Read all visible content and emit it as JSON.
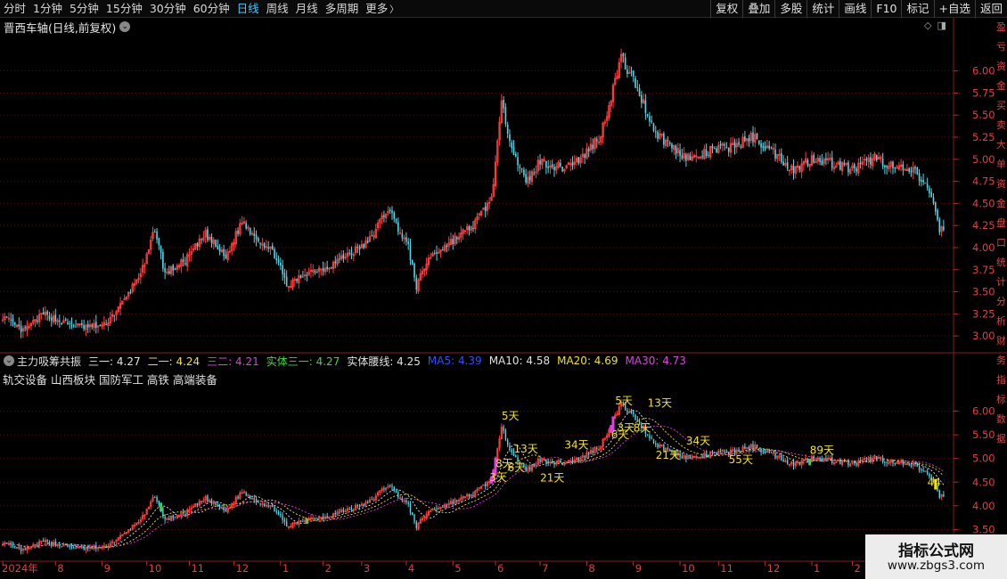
{
  "topbar": {
    "tabs": [
      {
        "label": "分时",
        "active": false
      },
      {
        "label": "1分钟",
        "active": false
      },
      {
        "label": "5分钟",
        "active": false
      },
      {
        "label": "15分钟",
        "active": false
      },
      {
        "label": "30分钟",
        "active": false
      },
      {
        "label": "60分钟",
        "active": false
      },
      {
        "label": "日线",
        "active": true
      },
      {
        "label": "周线",
        "active": false
      },
      {
        "label": "月线",
        "active": false
      },
      {
        "label": "多周期",
        "active": false
      },
      {
        "label": "更多",
        "active": false
      }
    ],
    "tools": [
      "复权",
      "叠加",
      "多股",
      "统计",
      "画线",
      "F10",
      "标记",
      "+自选",
      "返回"
    ]
  },
  "main_chart": {
    "title": "晋西车轴(日线,前复权)",
    "y_ticks": [
      "6.00",
      "5.75",
      "5.50",
      "5.25",
      "5.00",
      "4.75",
      "4.50",
      "4.25",
      "4.00",
      "3.75",
      "3.50",
      "3.25",
      "3.00"
    ]
  },
  "indicator": {
    "name": "主力吸筹共振",
    "items": [
      {
        "label": "三一: 4.27",
        "color": "#e0e0e0"
      },
      {
        "label": "二一: 4.24",
        "color": "#f5e400"
      },
      {
        "label": "三二: 4.21",
        "color": "#e040e0"
      },
      {
        "label": "实体三一: 4.27",
        "color": "#30e030"
      },
      {
        "label": "实体腰线: 4.25",
        "color": "#e0e0e0"
      },
      {
        "label": "MA5: 4.39",
        "color": "#3050ff"
      },
      {
        "label": "MA10: 4.58",
        "color": "#e0e0e0"
      },
      {
        "label": "MA20: 4.69",
        "color": "#f5e400"
      },
      {
        "label": "MA30: 4.73",
        "color": "#e040e0"
      }
    ],
    "concepts": "轨交设备  山西板块  国防军工 高铁 高端装备",
    "y_ticks": [
      "6.00",
      "5.50",
      "5.00",
      "4.50",
      "4.00",
      "3.50"
    ],
    "day_labels": [
      {
        "text": "5天",
        "price": 5.82,
        "idx": 246
      },
      {
        "text": "13天",
        "price": 5.13,
        "idx": 252
      },
      {
        "text": "3天",
        "price": 4.52,
        "idx": 240
      },
      {
        "text": "8天",
        "price": 4.82,
        "idx": 243
      },
      {
        "text": "6天",
        "price": 4.73,
        "idx": 249
      },
      {
        "text": "21天",
        "price": 4.51,
        "idx": 265
      },
      {
        "text": "34天",
        "price": 5.21,
        "idx": 277
      },
      {
        "text": "5天",
        "price": 6.14,
        "idx": 302
      },
      {
        "text": "13天",
        "price": 6.1,
        "idx": 318
      },
      {
        "text": "3天",
        "price": 5.57,
        "idx": 303
      },
      {
        "text": "8天",
        "price": 5.57,
        "idx": 311
      },
      {
        "text": "6天",
        "price": 5.43,
        "idx": 300
      },
      {
        "text": "34天",
        "price": 5.3,
        "idx": 337
      },
      {
        "text": "21天",
        "price": 4.99,
        "idx": 322
      },
      {
        "text": "55天",
        "price": 4.9,
        "idx": 358
      },
      {
        "text": "89天",
        "price": 5.1,
        "idx": 398
      },
      {
        "text": "44",
        "price": 4.42,
        "idx": 456
      }
    ]
  },
  "x_axis": [
    {
      "label": "2024年",
      "idx": 0
    },
    {
      "label": "8",
      "idx": 26
    },
    {
      "label": "9",
      "idx": 49
    },
    {
      "label": "10",
      "idx": 71
    },
    {
      "label": "11",
      "idx": 92
    },
    {
      "label": "12",
      "idx": 114
    },
    {
      "label": "1",
      "idx": 137
    },
    {
      "label": "2",
      "idx": 158
    },
    {
      "label": "3",
      "idx": 177
    },
    {
      "label": "4",
      "idx": 199
    },
    {
      "label": "5",
      "idx": 222
    },
    {
      "label": "6",
      "idx": 243
    },
    {
      "label": "7",
      "idx": 265
    },
    {
      "label": "8",
      "idx": 288
    },
    {
      "label": "9",
      "idx": 311
    },
    {
      "label": "10",
      "idx": 334
    },
    {
      "label": "11",
      "idx": 353
    },
    {
      "label": "12",
      "idx": 376
    },
    {
      "label": "1",
      "idx": 399
    },
    {
      "label": "2",
      "idx": 419
    }
  ],
  "right_edge_text": "盈亏资金买卖大单资金盘口统计分析财务指标数据",
  "watermark": {
    "line1": "指标公式网",
    "line2": "www.zbgs3.com"
  },
  "chart_data": {
    "type": "candlestick",
    "title": "晋西车轴(日线,前复权)",
    "price_range": [
      2.85,
      6.4
    ],
    "x_start_label": "2024年",
    "waypoints": [
      [
        0,
        3.22
      ],
      [
        10,
        3.05
      ],
      [
        20,
        3.25
      ],
      [
        30,
        3.15
      ],
      [
        40,
        3.1
      ],
      [
        50,
        3.12
      ],
      [
        60,
        3.4
      ],
      [
        70,
        3.8
      ],
      [
        75,
        4.22
      ],
      [
        80,
        3.7
      ],
      [
        90,
        3.85
      ],
      [
        100,
        4.15
      ],
      [
        110,
        3.88
      ],
      [
        118,
        4.3
      ],
      [
        125,
        4.12
      ],
      [
        135,
        3.9
      ],
      [
        140,
        3.55
      ],
      [
        150,
        3.72
      ],
      [
        160,
        3.78
      ],
      [
        170,
        3.92
      ],
      [
        180,
        4.05
      ],
      [
        190,
        4.45
      ],
      [
        200,
        4.0
      ],
      [
        204,
        3.56
      ],
      [
        210,
        3.88
      ],
      [
        220,
        4.05
      ],
      [
        232,
        4.25
      ],
      [
        241,
        4.55
      ],
      [
        246,
        5.6
      ],
      [
        252,
        5.1
      ],
      [
        258,
        4.72
      ],
      [
        265,
        4.98
      ],
      [
        275,
        4.9
      ],
      [
        285,
        5.0
      ],
      [
        295,
        5.28
      ],
      [
        305,
        6.15
      ],
      [
        312,
        5.85
      ],
      [
        322,
        5.3
      ],
      [
        332,
        5.1
      ],
      [
        340,
        5.0
      ],
      [
        350,
        5.1
      ],
      [
        360,
        5.15
      ],
      [
        370,
        5.25
      ],
      [
        380,
        5.08
      ],
      [
        390,
        4.88
      ],
      [
        400,
        5.02
      ],
      [
        410,
        4.95
      ],
      [
        420,
        4.88
      ],
      [
        430,
        5.02
      ],
      [
        440,
        4.9
      ],
      [
        450,
        4.85
      ],
      [
        458,
        4.6
      ],
      [
        462,
        4.2
      ]
    ],
    "n_candles": 465,
    "last_close": 4.2
  }
}
